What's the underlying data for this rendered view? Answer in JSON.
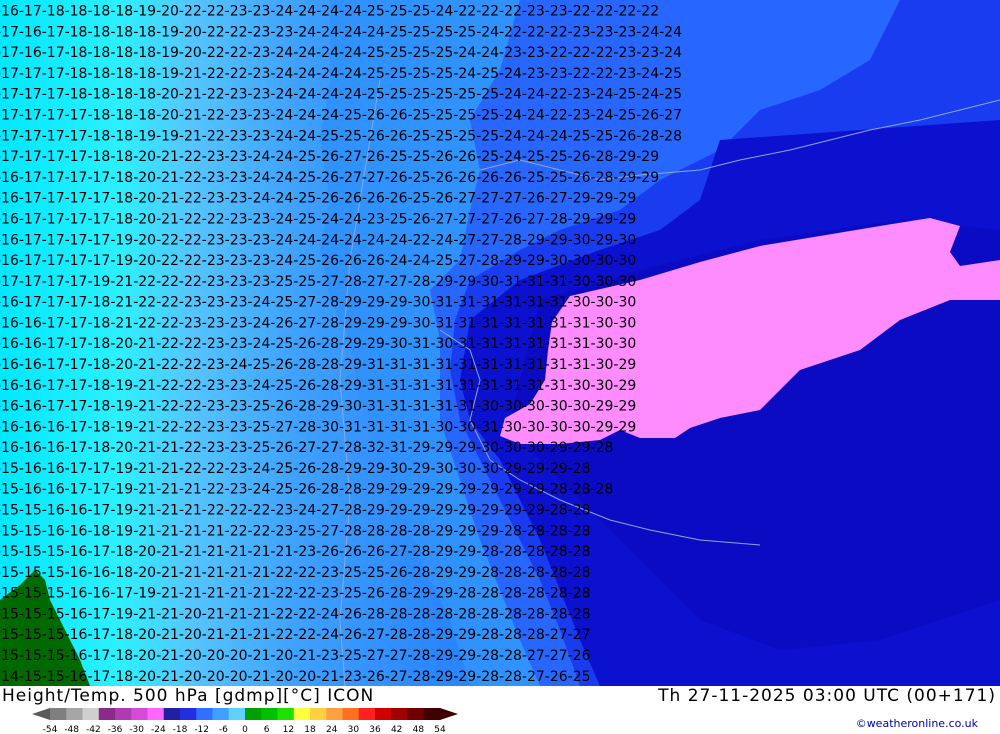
{
  "map": {
    "title": "Height/Temp. 500 hPa [gdmp][°C] ICON",
    "valid_time": "Th 27-11-2025 03:00 UTC (00+171)",
    "credit": "©weatheronline.co.uk",
    "contour_labels": {
      "rows": [
        "-16-17-18-18-18-18-19-20-22-22-23-23-24-24-24-24-25-25-25-24-22-22-22-23-23-22-22-22-22",
        "-17-16-17-18-18-18-18-19-20-22-22-23-23-24-24-24-24-25-25-25-25-24-22-22-22-23-23-23-24-24",
        "-17-16-17-18-18-18-18-19-20-22-22-23-24-24-24-24-25-25-25-25-24-24-23-23-22-22-22-23-23-24",
        "-17-17-17-18-18-18-18-19-21-22-22-23-24-24-24-24-25-25-25-25-24-25-24-23-23-22-22-23-24-25",
        "-17-17-17-18-18-18-18-20-21-22-23-23-24-24-24-24-25-25-25-25-25-25-24-24-22-23-24-25-24-25",
        "-17-17-17-17-18-18-18-20-21-22-23-23-24-24-24-25-26-26-25-25-25-25-24-24-22-23-24-25-26-27",
        "-17-17-17-17-18-18-19-19-21-22-23-23-24-24-25-25-26-26-25-25-25-25-24-24-24-25-25-26-28-28",
        "-17-17-17-17-18-18-20-21-22-23-23-24-24-25-26-27-26-25-25-26-26-25-24-25-25-26-28-29-29",
        "-16-17-17-17-17-18-20-21-22-23-23-24-24-25-26-27-27-26-25-26-26-26-26-25-25-26-28-29-29",
        "-16-17-17-17-17-18-20-21-22-23-23-24-24-25-26-26-26-26-25-26-27-27-27-26-27-29-29-29",
        "-16-17-17-17-17-18-20-21-22-22-23-23-24-25-24-24-23-25-26-27-27-27-26-27-28-29-29-29",
        "-16-17-17-17-17-19-20-22-22-23-23-23-24-24-24-24-24-24-22-24-27-27-28-29-29-30-29-30",
        "-16-17-17-17-17-19-20-22-22-23-23-23-24-25-26-26-26-24-24-25-27-28-29-29-30-30-30-30",
        "-17-17-17-17-19-21-22-22-22-23-23-23-25-25-27-28-27-27-28-29-29-30-31-31-31-30-30-30",
        "-16-17-17-17-18-21-22-22-23-23-23-24-25-27-28-29-29-29-30-31-31-31-31-31-31-30-30-30",
        "-16-16-17-17-18-21-22-22-23-23-23-24-26-27-28-29-29-29-30-31-31-31-31-31-31-31-30-30",
        "-16-16-17-17-18-20-21-22-22-23-23-24-25-26-28-29-29-30-31-30-31-31-31-31-31-31-30-30",
        "-16-16-17-17-18-20-21-22-22-23-24-25-26-28-28-29-31-31-31-31-31-31-31-31-31-31-30-29",
        "-16-16-17-17-18-19-21-22-22-23-23-24-25-26-28-29-31-31-31-31-31-31-31-31-31-30-30-29",
        "-16-16-17-17-18-19-21-22-22-23-23-25-26-28-29-30-31-31-31-31-31-30-30-30-30-30-29-29",
        "-16-16-16-17-18-19-21-22-22-23-23-25-27-28-30-31-31-31-31-30-30-31-30-30-30-30-29-29",
        "-16-16-16-17-18-20-21-21-22-23-23-25-26-27-27-28-32-31-29-29-29-30-30-30-29-29-28",
        "-15-16-16-17-17-19-21-21-22-22-23-24-25-26-28-29-29-30-29-30-30-30-29-29-29-28",
        "-15-16-16-17-17-19-21-21-21-22-23-24-25-26-28-28-29-29-29-29-29-29-29-29-28-28-28",
        "-15-15-16-16-17-19-21-21-21-22-22-22-23-24-27-28-29-29-29-29-29-29-29-29-28-28",
        "-15-15-16-16-18-19-21-21-21-21-22-22-23-25-27-28-28-28-28-29-29-29-28-28-28-28",
        "-15-15-15-16-17-18-20-21-21-21-21-21-21-23-26-26-26-27-28-29-29-28-28-28-28-28",
        "-15-15-15-16-16-18-20-21-21-21-21-21-22-22-23-25-25-26-28-29-29-28-28-28-28-28",
        "-15-15-15-16-16-17-19-21-21-21-21-21-22-22-23-25-26-28-29-29-28-28-28-28-28-28",
        "-15-15-15-16-17-19-21-21-20-21-21-21-22-22-24-26-28-28-28-28-28-28-28-28-28-28",
        "-15-15-15-16-17-18-20-21-20-21-21-21-22-22-24-26-27-28-28-29-29-28-28-28-27-27",
        "-15-15-15-16-17-18-20-21-20-20-20-21-20-21-23-25-27-27-28-29-29-28-28-27-27-26",
        "-14-15-15-16-17-18-20-21-20-20-20-21-20-20-21-23-26-27-28-29-29-28-28-27-26-25"
      ]
    },
    "legend": {
      "labels": [
        "-54",
        "-48",
        "-42",
        "-36",
        "-30",
        "-24",
        "-18",
        "-12",
        "-6",
        "0",
        "6",
        "12",
        "18",
        "24",
        "30",
        "36",
        "42",
        "48",
        "54"
      ],
      "colors": [
        "#7f7f7f",
        "#a6a6a6",
        "#cfcfcf",
        "#8a2b8a",
        "#b03ab0",
        "#d64ad6",
        "#ff66ff",
        "#2020a0",
        "#2030e0",
        "#3070ff",
        "#40a0ff",
        "#60d0ff",
        "#00a000",
        "#00c000",
        "#20e000",
        "#ffff40",
        "#ffd040",
        "#ffa040",
        "#ff7020",
        "#ff2020",
        "#d00000",
        "#a00000",
        "#700000",
        "#400000"
      ]
    },
    "colors": {
      "band_m16": "#00e8ff",
      "band_m18": "#37f2ff",
      "band_m20": "#52b8ff",
      "band_m24": "#2a8cff",
      "band_m28": "#1e5cff",
      "band_m30": "#0a0adc",
      "band_m32": "#ff88ff",
      "land_green": "#006a00"
    }
  }
}
